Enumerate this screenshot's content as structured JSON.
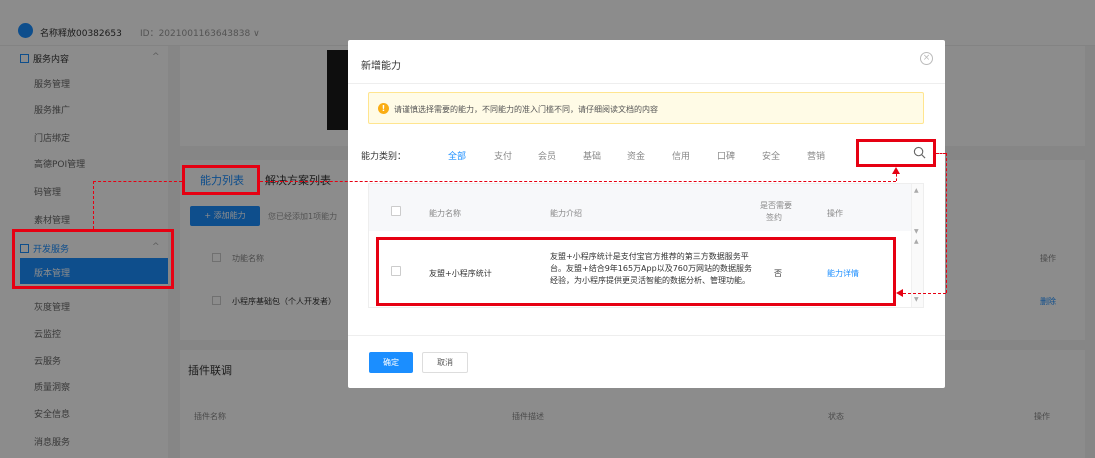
{
  "header": {
    "brand_name": "名称释放00382653",
    "brand_id": "ID：2021001163643838 ∨"
  },
  "sidebar": {
    "group_service": "服务内容",
    "items": [
      "服务管理",
      "服务推广",
      "门店绑定",
      "高德POI管理",
      "码管理",
      "素材管理"
    ],
    "group_dev": "开发服务",
    "active_item": "版本管理",
    "items2": [
      "灰度管理",
      "云监控",
      "云服务",
      "质量洞察",
      "安全信息",
      "消息服务"
    ]
  },
  "background": {
    "tab_ability_list": "能力列表",
    "tab_solution_list": "解决方案列表",
    "add_button": "+ 添加能力",
    "add_hint": "您已经添加1项能力",
    "col_func_name": "功能名称",
    "row_name": "小程序基础包（个人开发者）",
    "col_op": "操作",
    "delete_link": "删除",
    "plugin_title": "插件联调",
    "plugin_col_name": "插件名称",
    "plugin_col_desc": "插件描述",
    "plugin_col_status": "状态",
    "plugin_col_op": "操作"
  },
  "modal": {
    "title": "新增能力",
    "close_glyph": "×",
    "alert_icon": "!",
    "alert_text": "请谨慎选择需要的能力，不同能力的准入门槛不同，请仔细阅读文档的内容",
    "category_label": "能力类别：",
    "categories": [
      "全部",
      "支付",
      "会员",
      "基础",
      "资金",
      "信用",
      "口碑",
      "安全",
      "营销"
    ],
    "active_category": 0,
    "table": {
      "col_name": "能力名称",
      "col_intro": "能力介绍",
      "col_sign_line1": "是否需要",
      "col_sign_line2": "签约",
      "col_op": "操作",
      "row": {
        "name": "友盟+小程序统计",
        "intro_line1": "友盟+小程序统计是支付宝官方推荐的第三方数据服务平",
        "intro_line2": "台。友盟+结合9年165万App以及760万网站的数据服务",
        "intro_line3": "经验，为小程序提供更灵活智能的数据分析、管理功能。",
        "sign": "否",
        "detail_link": "能力详情"
      }
    },
    "ok_button": "确定",
    "cancel_button": "取消"
  },
  "colors": {
    "accent": "#1b8eff",
    "annotation": "#e60012",
    "warning": "#faad14"
  }
}
